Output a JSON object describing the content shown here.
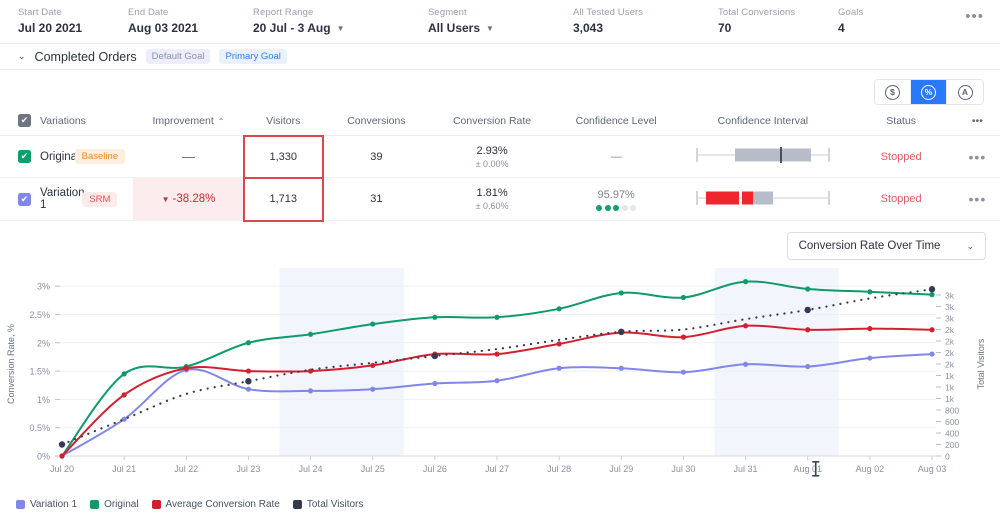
{
  "topbar": {
    "stats": [
      {
        "label": "Start Date",
        "value": "Jul 20 2021",
        "caret": false
      },
      {
        "label": "End Date",
        "value": "Aug 03 2021",
        "caret": false
      },
      {
        "label": "Report Range",
        "value": "20 Jul - 3 Aug",
        "caret": true
      },
      {
        "label": "Segment",
        "value": "All Users",
        "caret": true
      },
      {
        "label": "All Tested Users",
        "value": "3,043",
        "caret": false
      },
      {
        "label": "Total Conversions",
        "value": "70",
        "caret": false
      },
      {
        "label": "Goals",
        "value": "4",
        "caret": false
      }
    ],
    "more_label": "•••"
  },
  "goal": {
    "chevron": "⌄",
    "title": "Completed Orders",
    "badge_default": "Default Goal",
    "badge_primary": "Primary Goal"
  },
  "metric_toggle": {
    "buttons": [
      {
        "name": "revenue-toggle",
        "glyph": "$",
        "active": false
      },
      {
        "name": "percent-toggle",
        "glyph": "%",
        "active": true
      },
      {
        "name": "average-toggle",
        "glyph": "A",
        "active": false
      }
    ]
  },
  "table": {
    "headers": {
      "variations": "Variations",
      "improvement": "Improvement",
      "improvement_sort": "⌃",
      "visitors": "Visitors",
      "conversions": "Conversions",
      "conversion_rate": "Conversion Rate",
      "confidence_level": "Confidence Level",
      "confidence_interval": "Confidence Interval",
      "status": "Status",
      "more": "•••"
    },
    "rows": [
      {
        "name": "Original",
        "badge": "Baseline",
        "badge_type": "baseline",
        "checkbox_color": "green",
        "improvement": "—",
        "improvement_highlighted": false,
        "visitors": "1,330",
        "visitors_highlighted": true,
        "conversions": "39",
        "conversion_rate": "2.93%",
        "conversion_rate_margin": "± 0.00%",
        "confidence_level": "—",
        "confidence_dots_on": 0,
        "confidence_dots_total": 0,
        "status": "Stopped",
        "more": "•••"
      },
      {
        "name": "Variation 1",
        "badge": "SRM",
        "badge_type": "srm",
        "checkbox_color": "purple",
        "improvement": "-38.28%",
        "improvement_arrow": "▼",
        "improvement_highlighted": true,
        "visitors": "1,713",
        "visitors_highlighted": true,
        "conversions": "31",
        "conversion_rate": "1.81%",
        "conversion_rate_margin": "± 0.60%",
        "confidence_level": "95.97%",
        "confidence_dots_on": 3,
        "confidence_dots_total": 5,
        "status": "Stopped",
        "more": "•••"
      }
    ]
  },
  "chart_selector": {
    "label": "Conversion Rate Over Time",
    "caret": "⌄"
  },
  "chart_data": {
    "type": "line",
    "title": "Conversion Rate Over Time",
    "xlabel": "",
    "ylabel": "Conversion Rate, %",
    "y2label": "Total Visitors",
    "ylim": [
      0,
      3.25
    ],
    "y2lim": [
      0,
      3200
    ],
    "grid": true,
    "legend_position": "bottom-left",
    "x": [
      "Jul 20",
      "Jul 21",
      "Jul 22",
      "Jul 23",
      "Jul 24",
      "Jul 25",
      "Jul 26",
      "Jul 27",
      "Jul 28",
      "Jul 29",
      "Jul 30",
      "Jul 31",
      "Aug 01",
      "Aug 02",
      "Aug 03"
    ],
    "yticks": [
      "0%",
      "0.5%",
      "1%",
      "1.5%",
      "2%",
      "2.5%",
      "3%"
    ],
    "ytickvals": [
      0,
      0.5,
      1,
      1.5,
      2,
      2.5,
      3
    ],
    "y2ticks": [
      "0",
      "200",
      "400",
      "600",
      "800",
      "1k",
      "1k",
      "1k",
      "2k",
      "2k",
      "2k",
      "2k",
      "3k",
      "3k",
      "3k"
    ],
    "y2tickvals": [
      0,
      200,
      400,
      600,
      800,
      1000,
      1200,
      1400,
      1600,
      1800,
      2000,
      2200,
      2400,
      2600,
      2800
    ],
    "series": [
      {
        "name": "Variation 1",
        "color": "#8187e8",
        "axis": "left",
        "style": "solid",
        "values": [
          0.0,
          0.65,
          1.52,
          1.18,
          1.15,
          1.18,
          1.28,
          1.33,
          1.55,
          1.55,
          1.48,
          1.62,
          1.58,
          1.73,
          1.8
        ]
      },
      {
        "name": "Original",
        "color": "#0f9a6a",
        "axis": "left",
        "style": "solid",
        "values": [
          0.0,
          1.45,
          1.58,
          2.0,
          2.15,
          2.33,
          2.45,
          2.45,
          2.6,
          2.88,
          2.8,
          3.08,
          2.95,
          2.9,
          2.85
        ]
      },
      {
        "name": "Average Conversion Rate",
        "color": "#d32030",
        "axis": "left",
        "style": "solid",
        "values": [
          0.0,
          1.08,
          1.55,
          1.5,
          1.5,
          1.6,
          1.8,
          1.8,
          1.98,
          2.18,
          2.1,
          2.3,
          2.23,
          2.25,
          2.23
        ]
      },
      {
        "name": "Total Visitors",
        "color": "#343a52",
        "axis": "right",
        "style": "dotted",
        "values": [
          200,
          640,
          1080,
          1300,
          1500,
          1620,
          1740,
          1860,
          2020,
          2160,
          2200,
          2380,
          2540,
          2740,
          2900
        ]
      }
    ],
    "highlight_bands": [
      {
        "from": "Jul 23.5",
        "to": "Jul 25.5"
      },
      {
        "from": "Jul 30.5",
        "to": "Aug 01.5"
      }
    ]
  },
  "legend": [
    {
      "label": "Variation 1",
      "color": "#8187e8"
    },
    {
      "label": "Original",
      "color": "#0f9a6a"
    },
    {
      "label": "Average Conversion Rate",
      "color": "#d32030"
    },
    {
      "label": "Total Visitors",
      "color": "#343a52"
    }
  ]
}
